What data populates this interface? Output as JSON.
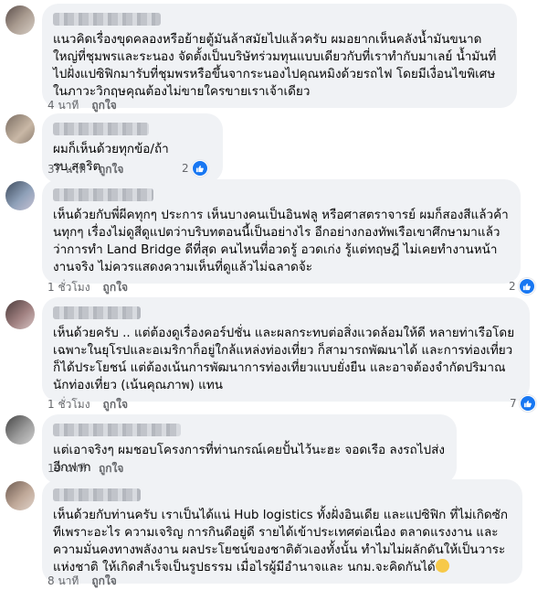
{
  "comments": [
    {
      "text": "แนวคิดเรื่องขุดคลองหรือย้ายตู้มันล้าสมัยไปแล้วครับ ผมอยากเห็นคลังน้ำมันขนาดใหญ่ที่ชุมพรและระนอง จัดตั้งเป็นบริษัทร่วมทุนแบบเดียวกับที่เราทำกับมาเลย์ น้ำมันที่ไปฝั่งแปซิฟิกมารับที่ชุมพรหรือขึ้นจากระนองไปคุณหมิงด้วยรถไฟ โดยมีเงื่อนไขพิเศษ ในภาวะวิกฤษคุณต้องไม่ขายใครขายเราเจ้าเดียว",
      "time": "4 นาที",
      "like_label": "ถูกใจ",
      "reaction_count": ""
    },
    {
      "text": "ผมก็เห็นด้วยทุกข้อ/ถ้ารบ.สุจริต",
      "time": "37 นาที",
      "like_label": "ถูกใจ",
      "reaction_count": "2"
    },
    {
      "text": "เห็นด้วยกับพี่ผีคทุกๆ ประการ เห็นบางคนเป็นอินฟลู หรือศาสตราจารย์ ผมก็สองสีแล้วค้านทุกๆ เรื่องไม่ดูสีดูแปตว่าบริบทตอนนี้เป็นอย่างไร อีกอย่างกองทัพเรือเขาศึกษามาแล้วว่าการทำ Land Bridge ดีที่สุด คนไหนที่อวดรู้ อวดเก่ง รู้แต่ทฤษฎี ไม่เคยทำงานหน้างานจริง ไม่ควรแสดงความเห็นที่ดูแล้วไม่ฉลาดจ้ะ",
      "time": "1 ชั่วโมง",
      "like_label": "ถูกใจ",
      "reaction_count": "2"
    },
    {
      "text": "เห็นด้วยครับ .. แต่ต้องดูเรื่องคอร์ปชั่น และผลกระทบต่อสิ่งแวดล้อมให้ดี หลายท่าเรือโดยเฉพาะในยุโรปและอเมริกาก็อยู่ใกล้แหล่งท่องเที่ยว ก็สามารถพัฒนาได้ และการท่องเที่ยวก็ได้ประโยชน์ แต่ต้องเน้นการพัฒนาการท่องเที่ยวแบบยั่งยืน และอาจต้องจำกัดปริมาณนักท่องเที่ยว (เน้นคุณภาพ) แทน",
      "time": "1 ชั่วโมง",
      "like_label": "ถูกใจ",
      "reaction_count": "7"
    },
    {
      "text": "แต่เอาจริงๆ ผมชอบโครงการที่ท่านกรณ์เคยปั้นไว้นะฮะ จอดเรือ ลงรถไปส่งอีกฟาก",
      "time": "19 นาที",
      "like_label": "ถูกใจ",
      "reaction_count": ""
    },
    {
      "text": "เห็นด้วยกับท่านครับ เราเป็นได้แน่ Hub logistics ทั้งฝั่งอินเดีย และแปซิฟิก ที่ไม่เกิดซักทีเพราะอะไร ความเจริญ การกินดีอยู่ดี รายได้เข้าประเทศต่อเนื่อง ตลาดแรงงาน และความมั่นคงทางพลังงาน ผลประโยชน์ของชาติตัวเองทั้งนั้น ทำไมไม่ผลักดันให้เป็นวาระแห่งชาติ ให้เกิดสำเร็จเป็นรูปธรรม เมื่อไรผู้มีอำนาจและ นกม.จะคิดกันได้",
      "time": "8 นาที",
      "like_label": "ถูกใจ",
      "reaction_count": ""
    }
  ],
  "colors": {
    "bubble": "#f0f2f5",
    "meta": "#65676b",
    "like_blue": "#1877f2"
  }
}
